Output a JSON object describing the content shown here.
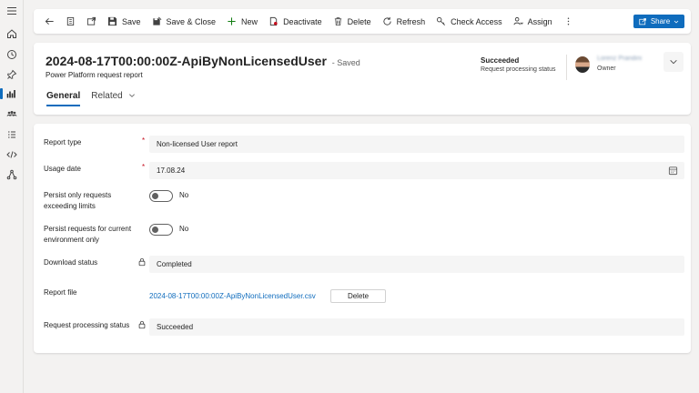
{
  "rail": {
    "icons": [
      "hamburger-icon",
      "home-icon",
      "recent-icon",
      "pin-icon",
      "reports-icon",
      "users-icon",
      "list-icon",
      "code-icon",
      "flow-icon"
    ]
  },
  "commands": {
    "save": "Save",
    "save_close": "Save & Close",
    "new": "New",
    "deactivate": "Deactivate",
    "delete": "Delete",
    "refresh": "Refresh",
    "check_access": "Check Access",
    "assign": "Assign",
    "share": "Share"
  },
  "header": {
    "title": "2024-08-17T00:00:00Z-ApiByNonLicensedUser",
    "save_status": "- Saved",
    "entity": "Power Platform request report",
    "status_value": "Succeeded",
    "status_label": "Request processing status",
    "owner_name": "Lorenz Prandini",
    "owner_label": "Owner"
  },
  "tabs": {
    "general": "General",
    "related": "Related"
  },
  "form": {
    "report_type_label": "Report type",
    "report_type_value": "Non-licensed User report",
    "usage_date_label": "Usage date",
    "usage_date_value": "17.08.24",
    "persist_limits_label": "Persist only requests exceeding limits",
    "persist_limits_value": "No",
    "persist_env_label": "Persist requests for current environment only",
    "persist_env_value": "No",
    "download_status_label": "Download status",
    "download_status_value": "Completed",
    "report_file_label": "Report file",
    "report_file_name": "2024-08-17T00:00:00Z-ApiByNonLicensedUser.csv",
    "report_file_delete": "Delete",
    "processing_status_label": "Request processing status",
    "processing_status_value": "Succeeded",
    "required_mark": "*"
  },
  "colors": {
    "accent": "#0f6cbd",
    "required": "#c50f1f",
    "new_icon": "#107c10"
  }
}
